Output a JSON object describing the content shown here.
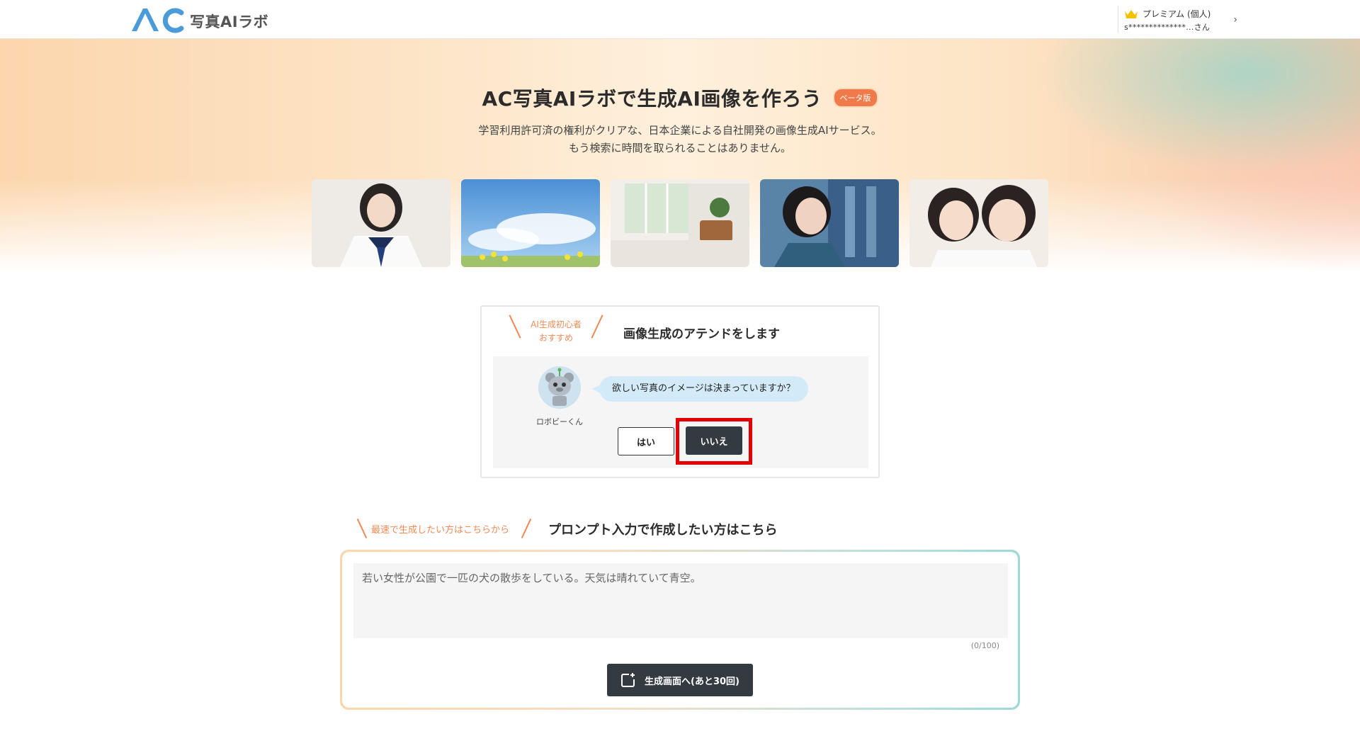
{
  "header": {
    "logo_text": "写真AIラボ",
    "plan_label": "プレミアム (個人)",
    "user_label": "s**************...さん",
    "chevron": "›"
  },
  "hero": {
    "title": "AC写真AIラボで生成AI画像を作ろう",
    "badge": "ベータ版",
    "subtitle_line1": "学習利用許可済の権利がクリアな、日本企業による自社開発の画像生成AIサービス。",
    "subtitle_line2": "もう検索に時間を取られることはありません。"
  },
  "gallery": {
    "items": [
      "girl-studying-image",
      "blue-sky-image",
      "interior-room-image",
      "woman-profile-image",
      "children-image"
    ]
  },
  "attend": {
    "tag_line1": "AI生成初心者",
    "tag_line2": "おすすめ",
    "title": "画像生成のアテンドをします",
    "bot_name": "ロボビーくん",
    "question": "欲しい写真のイメージは決まっていますか？",
    "yes_label": "はい",
    "no_label": "いいえ"
  },
  "prompt": {
    "tag": "最速で生成したい方はこちらから",
    "title": "プロンプト入力で作成したい方はこちら",
    "placeholder": "若い女性が公園で一匹の犬の散歩をしている。天気は晴れていて青空。",
    "counter": "(0/100)",
    "generate_label": "生成画面へ(あと30回)"
  },
  "colors": {
    "accent_orange": "#f08a55",
    "dark_button": "#333a40",
    "highlight_red": "#e30000",
    "bubble_blue": "#d3ebf9",
    "logo_blue": "#4a9bd8"
  }
}
